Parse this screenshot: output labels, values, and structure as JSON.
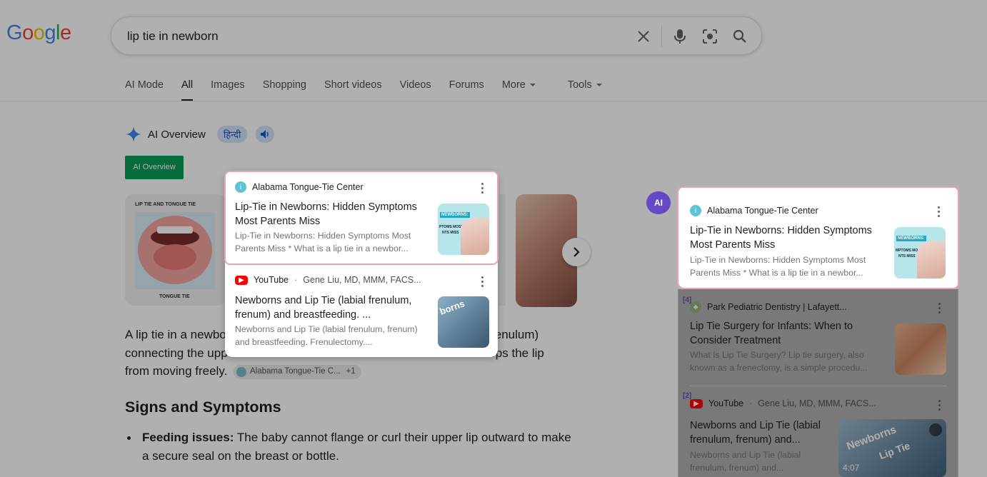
{
  "header": {
    "logo": [
      "G",
      "o",
      "o",
      "g",
      "l",
      "e"
    ],
    "logo_colors": [
      "#4285f4",
      "#ea4335",
      "#fbbc05",
      "#4285f4",
      "#34a853",
      "#ea4335"
    ],
    "query": "lip tie in newborn"
  },
  "tabs": [
    {
      "label": "AI Mode"
    },
    {
      "label": "All"
    },
    {
      "label": "Images"
    },
    {
      "label": "Shopping"
    },
    {
      "label": "Short videos"
    },
    {
      "label": "Videos"
    },
    {
      "label": "Forums"
    },
    {
      "label": "More"
    },
    {
      "label": "Tools"
    }
  ],
  "ai_overview": {
    "title": "AI Overview",
    "lang_pill": "हिन्दी",
    "badge": "AI Overview",
    "image_label_top": "LIP TIE AND TONGUE TIE",
    "image_label_bottom": "TONGUE TIE",
    "text_line1_a": "A lip tie in a newbo",
    "text_line1_b": "enulum)",
    "text_line2_a": "connecting the uppe",
    "text_line2_b": "stops the lip",
    "text_line3": "from moving freely",
    "cite_source": "Alabama Tongue-Tie C...",
    "cite_more": "+1",
    "section_title": "Signs and Symptoms",
    "bullet_bold": "Feeding issues:",
    "bullet_text": " The baby cannot flange or curl their upper lip outward to make",
    "bullet_text2": "a secure seal on the breast or bottle."
  },
  "popup": {
    "card1": {
      "source": "Alabama Tongue-Tie Center",
      "title": "Lip-Tie in Newborns: Hidden Symptoms Most Parents Miss",
      "snippet": "Lip-Tie in Newborns: Hidden Symptoms Most Parents Miss * What is a lip tie in a newbor...",
      "thumb_text": "NEWBORNS:",
      "thumb_text2": "PTOMS MOST",
      "thumb_text3": "NTS MISS"
    },
    "card2": {
      "source": "YouTube",
      "author": "Gene Liu, MD, MMM, FACS...",
      "title": "Newborns and Lip Tie (labial frenulum, frenum) and breastfeeding. ...",
      "snippet": "Newborns and Lip Tie (labial frenulum, frenum) and breastfeeding. Frenulectomy....",
      "thumb_text": "borns"
    }
  },
  "right_panel": {
    "ai_badge": "AI",
    "card1": {
      "source": "Alabama Tongue-Tie Center",
      "title": "Lip-Tie in Newborns: Hidden Symptoms Most Parents Miss",
      "snippet": "Lip-Tie in Newborns: Hidden Symptoms Most Parents Miss * What is a lip tie in a newbor...",
      "thumb_text": "NEWBORNS:",
      "thumb_text2": "MPTOMS MOST",
      "thumb_text3": "NTS MISS"
    },
    "card2": {
      "num": "[4]",
      "source": "Park Pediatric Dentistry | Lafayett...",
      "title": "Lip Tie Surgery for Infants: When to Consider Treatment",
      "snippet": "What Is Lip Tie Surgery? Lip tie surgery, also known as a frenectomy, is a simple procedu..."
    },
    "card3": {
      "num": "[2]",
      "source": "YouTube",
      "author": "Gene Liu, MD, MMM, FACS...",
      "title": "Newborns and Lip Tie (labial frenulum, frenum) and...",
      "snippet": "Newborns and Lip Tie (labial frenulum, frenum) and...",
      "duration": "4:07",
      "thumb_text": "Newborns",
      "thumb_text2": "Lip Tie"
    }
  }
}
